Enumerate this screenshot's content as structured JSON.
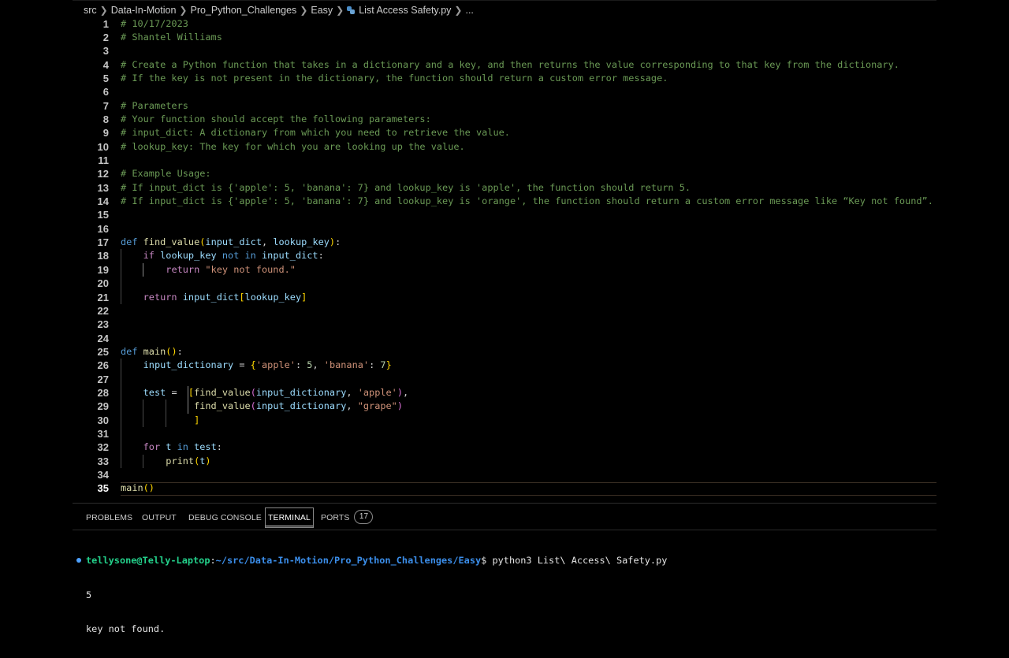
{
  "breadcrumb": {
    "items": [
      "src",
      "Data-In-Motion",
      "Pro_Python_Challenges",
      "Easy",
      "List Access Safety.py",
      "..."
    ]
  },
  "editor": {
    "lines": [
      {
        "n": "1",
        "segs": [
          [
            "cm",
            "# 10/17/2023"
          ]
        ]
      },
      {
        "n": "2",
        "segs": [
          [
            "cm",
            "# Shantel Williams"
          ]
        ]
      },
      {
        "n": "3",
        "segs": []
      },
      {
        "n": "4",
        "segs": [
          [
            "cm",
            "# Create a Python function that takes in a dictionary and a key, and then returns the value corresponding to that key from the dictionary."
          ]
        ]
      },
      {
        "n": "5",
        "segs": [
          [
            "cm",
            "# If the key is not present in the dictionary, the function should return a custom error message."
          ]
        ]
      },
      {
        "n": "6",
        "segs": []
      },
      {
        "n": "7",
        "segs": [
          [
            "cm",
            "# Parameters"
          ]
        ]
      },
      {
        "n": "8",
        "segs": [
          [
            "cm",
            "# Your function should accept the following parameters:"
          ]
        ]
      },
      {
        "n": "9",
        "segs": [
          [
            "cm",
            "# input_dict: A dictionary from which you need to retrieve the value."
          ]
        ]
      },
      {
        "n": "10",
        "segs": [
          [
            "cm",
            "# lookup_key: The key for which you are looking up the value."
          ]
        ]
      },
      {
        "n": "11",
        "segs": []
      },
      {
        "n": "12",
        "segs": [
          [
            "cm",
            "# Example Usage:"
          ]
        ]
      },
      {
        "n": "13",
        "segs": [
          [
            "cm",
            "# If input_dict is {'apple': 5, 'banana': 7} and lookup_key is 'apple', the function should return 5."
          ]
        ]
      },
      {
        "n": "14",
        "segs": [
          [
            "cm",
            "# If input_dict is {'apple': 5, 'banana': 7} and lookup_key is 'orange', the function should return a custom error message like “Key not found”."
          ]
        ]
      },
      {
        "n": "15",
        "segs": []
      },
      {
        "n": "16",
        "segs": []
      },
      {
        "n": "17",
        "segs": [
          [
            "kw",
            "def "
          ],
          [
            "fn",
            "find_value"
          ],
          [
            "p1",
            "("
          ],
          [
            "var",
            "input_dict"
          ],
          [
            "tx",
            ", "
          ],
          [
            "var",
            "lookup_key"
          ],
          [
            "p1",
            ")"
          ],
          [
            "tx",
            ":"
          ]
        ]
      },
      {
        "n": "18",
        "segs": [
          [
            "tx",
            "    "
          ],
          [
            "ctl",
            "if "
          ],
          [
            "var",
            "lookup_key"
          ],
          [
            "kw",
            " not in "
          ],
          [
            "var",
            "input_dict"
          ],
          [
            "tx",
            ":"
          ]
        ]
      },
      {
        "n": "19",
        "segs": [
          [
            "tx",
            "        "
          ],
          [
            "ctl",
            "return "
          ],
          [
            "str",
            "\"key not found.\""
          ]
        ]
      },
      {
        "n": "20",
        "segs": []
      },
      {
        "n": "21",
        "segs": [
          [
            "tx",
            "    "
          ],
          [
            "ctl",
            "return "
          ],
          [
            "var",
            "input_dict"
          ],
          [
            "p1",
            "["
          ],
          [
            "var",
            "lookup_key"
          ],
          [
            "p1",
            "]"
          ]
        ]
      },
      {
        "n": "22",
        "segs": []
      },
      {
        "n": "23",
        "segs": []
      },
      {
        "n": "24",
        "segs": []
      },
      {
        "n": "25",
        "segs": [
          [
            "kw",
            "def "
          ],
          [
            "fn",
            "main"
          ],
          [
            "p1",
            "()"
          ],
          [
            "tx",
            ":"
          ]
        ]
      },
      {
        "n": "26",
        "segs": [
          [
            "tx",
            "    "
          ],
          [
            "var",
            "input_dictionary"
          ],
          [
            "tx",
            " = "
          ],
          [
            "p1",
            "{"
          ],
          [
            "str",
            "'apple'"
          ],
          [
            "tx",
            ": "
          ],
          [
            "num",
            "5"
          ],
          [
            "tx",
            ", "
          ],
          [
            "str",
            "'banana'"
          ],
          [
            "tx",
            ": "
          ],
          [
            "num",
            "7"
          ],
          [
            "p1",
            "}"
          ]
        ]
      },
      {
        "n": "27",
        "segs": []
      },
      {
        "n": "28",
        "segs": [
          [
            "tx",
            "    "
          ],
          [
            "var",
            "test"
          ],
          [
            "tx",
            " =  "
          ],
          [
            "p1",
            "["
          ],
          [
            "fn",
            "find_value"
          ],
          [
            "p2",
            "("
          ],
          [
            "var",
            "input_dictionary"
          ],
          [
            "tx",
            ", "
          ],
          [
            "str",
            "'apple'"
          ],
          [
            "p2",
            ")"
          ],
          [
            "tx",
            ","
          ]
        ]
      },
      {
        "n": "29",
        "segs": [
          [
            "tx",
            "             "
          ],
          [
            "fn",
            "find_value"
          ],
          [
            "p2",
            "("
          ],
          [
            "var",
            "input_dictionary"
          ],
          [
            "tx",
            ", "
          ],
          [
            "str",
            "\"grape\""
          ],
          [
            "p2",
            ")"
          ]
        ]
      },
      {
        "n": "30",
        "segs": [
          [
            "tx",
            "             "
          ],
          [
            "p1",
            "]"
          ]
        ]
      },
      {
        "n": "31",
        "segs": []
      },
      {
        "n": "32",
        "segs": [
          [
            "tx",
            "    "
          ],
          [
            "ctl",
            "for "
          ],
          [
            "var",
            "t"
          ],
          [
            "kw",
            " in "
          ],
          [
            "var",
            "test"
          ],
          [
            "tx",
            ":"
          ]
        ]
      },
      {
        "n": "33",
        "segs": [
          [
            "tx",
            "        "
          ],
          [
            "fn",
            "print"
          ],
          [
            "p1",
            "("
          ],
          [
            "var",
            "t"
          ],
          [
            "p1",
            ")"
          ]
        ]
      },
      {
        "n": "34",
        "segs": []
      },
      {
        "n": "35",
        "segs": [
          [
            "fn",
            "main"
          ],
          [
            "p1",
            "()"
          ]
        ],
        "active": true
      }
    ]
  },
  "panel": {
    "tabs": [
      "PROBLEMS",
      "OUTPUT",
      "DEBUG CONSOLE",
      "TERMINAL",
      "PORTS"
    ],
    "active_tab": "TERMINAL",
    "ports_count": "17"
  },
  "terminal": {
    "prompt_user": "tellysone@Telly-Laptop",
    "prompt_sep": ":",
    "prompt_path": "~/src/Data-In-Motion/Pro_Python_Challenges/Easy",
    "prompt_end": "$ ",
    "command": "python3 List\\ Access\\ Safety.py",
    "output": [
      "5",
      "key not found."
    ]
  },
  "colors": {
    "background": "#000000",
    "comment": "#6a9955",
    "keyword": "#569cd6",
    "control": "#c586c0",
    "function": "#dcdcaa",
    "variable": "#9cdcfe",
    "string": "#ce9178",
    "number": "#b5cea8",
    "bracket1": "#ffd700",
    "bracket2": "#da70d6",
    "terminal_user": "#23d18b",
    "terminal_path": "#3b8eea"
  },
  "icons": {
    "breadcrumb_separator": "chevron-right-icon",
    "file_icon": "python-file-icon"
  }
}
